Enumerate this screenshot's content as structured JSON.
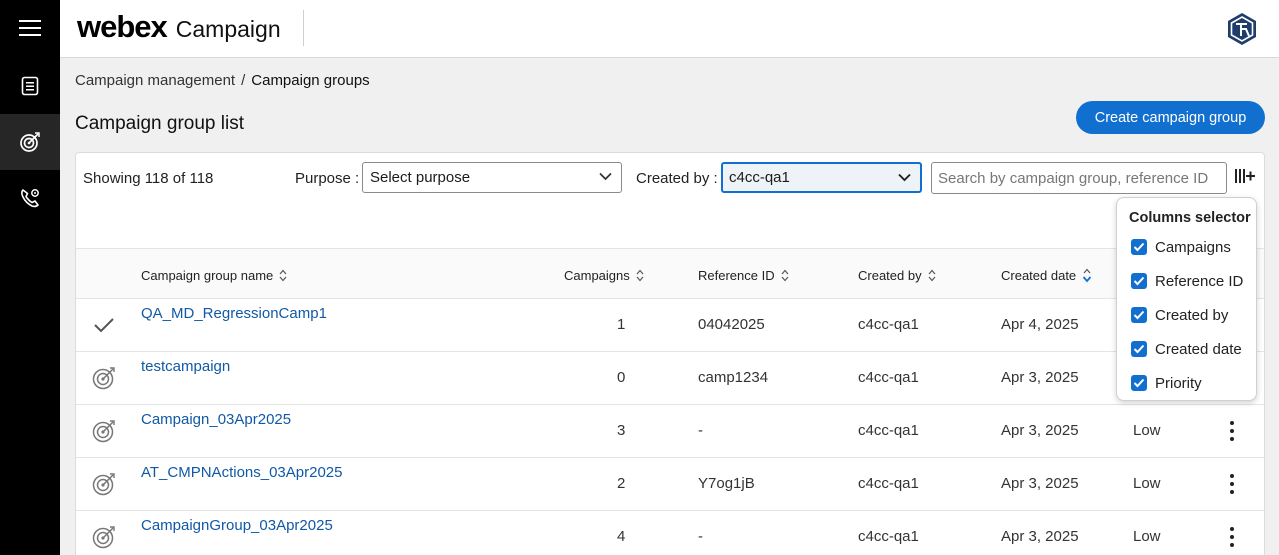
{
  "app": {
    "logo": "webex",
    "product": "Campaign"
  },
  "breadcrumb": {
    "parent": "Campaign management",
    "separator": "/",
    "current": "Campaign groups"
  },
  "page": {
    "title": "Campaign group list",
    "create_button": "Create campaign group"
  },
  "toolbar": {
    "showing": "Showing 118 of 118",
    "purpose_label": "Purpose :",
    "purpose_value": "Select purpose",
    "created_by_label": "Created by :",
    "created_by_value": "c4cc-qa1",
    "search_placeholder": "Search by campaign group, reference ID"
  },
  "table": {
    "headers": {
      "name": "Campaign group name",
      "campaigns": "Campaigns",
      "reference_id": "Reference ID",
      "created_by": "Created by",
      "created_date": "Created date"
    },
    "rows": [
      {
        "status_icon": "check-icon",
        "name": "QA_MD_RegressionCamp1",
        "campaigns": "1",
        "reference_id": "04042025",
        "created_by": "c4cc-qa1",
        "created_date": "Apr 4, 2025",
        "priority": ""
      },
      {
        "status_icon": "target-icon",
        "name": "testcampaign",
        "campaigns": "0",
        "reference_id": "camp1234",
        "created_by": "c4cc-qa1",
        "created_date": "Apr 3, 2025",
        "priority": ""
      },
      {
        "status_icon": "target-icon",
        "name": "Campaign_03Apr2025",
        "campaigns": "3",
        "reference_id": "-",
        "created_by": "c4cc-qa1",
        "created_date": "Apr 3, 2025",
        "priority": "Low"
      },
      {
        "status_icon": "target-icon",
        "name": "AT_CMPNActions_03Apr2025",
        "campaigns": "2",
        "reference_id": "Y7og1jB",
        "created_by": "c4cc-qa1",
        "created_date": "Apr 3, 2025",
        "priority": "Low"
      },
      {
        "status_icon": "target-icon",
        "name": "CampaignGroup_03Apr2025",
        "campaigns": "4",
        "reference_id": "-",
        "created_by": "c4cc-qa1",
        "created_date": "Apr 3, 2025",
        "priority": "Low"
      }
    ]
  },
  "columns_selector": {
    "title": "Columns selector",
    "options": [
      {
        "label": "Campaigns",
        "checked": true
      },
      {
        "label": "Reference ID",
        "checked": true
      },
      {
        "label": "Created by",
        "checked": true
      },
      {
        "label": "Created date",
        "checked": true
      },
      {
        "label": "Priority",
        "checked": true
      }
    ]
  },
  "colors": {
    "accent": "#1170cf",
    "link": "#1159a6",
    "rail": "#000000"
  }
}
